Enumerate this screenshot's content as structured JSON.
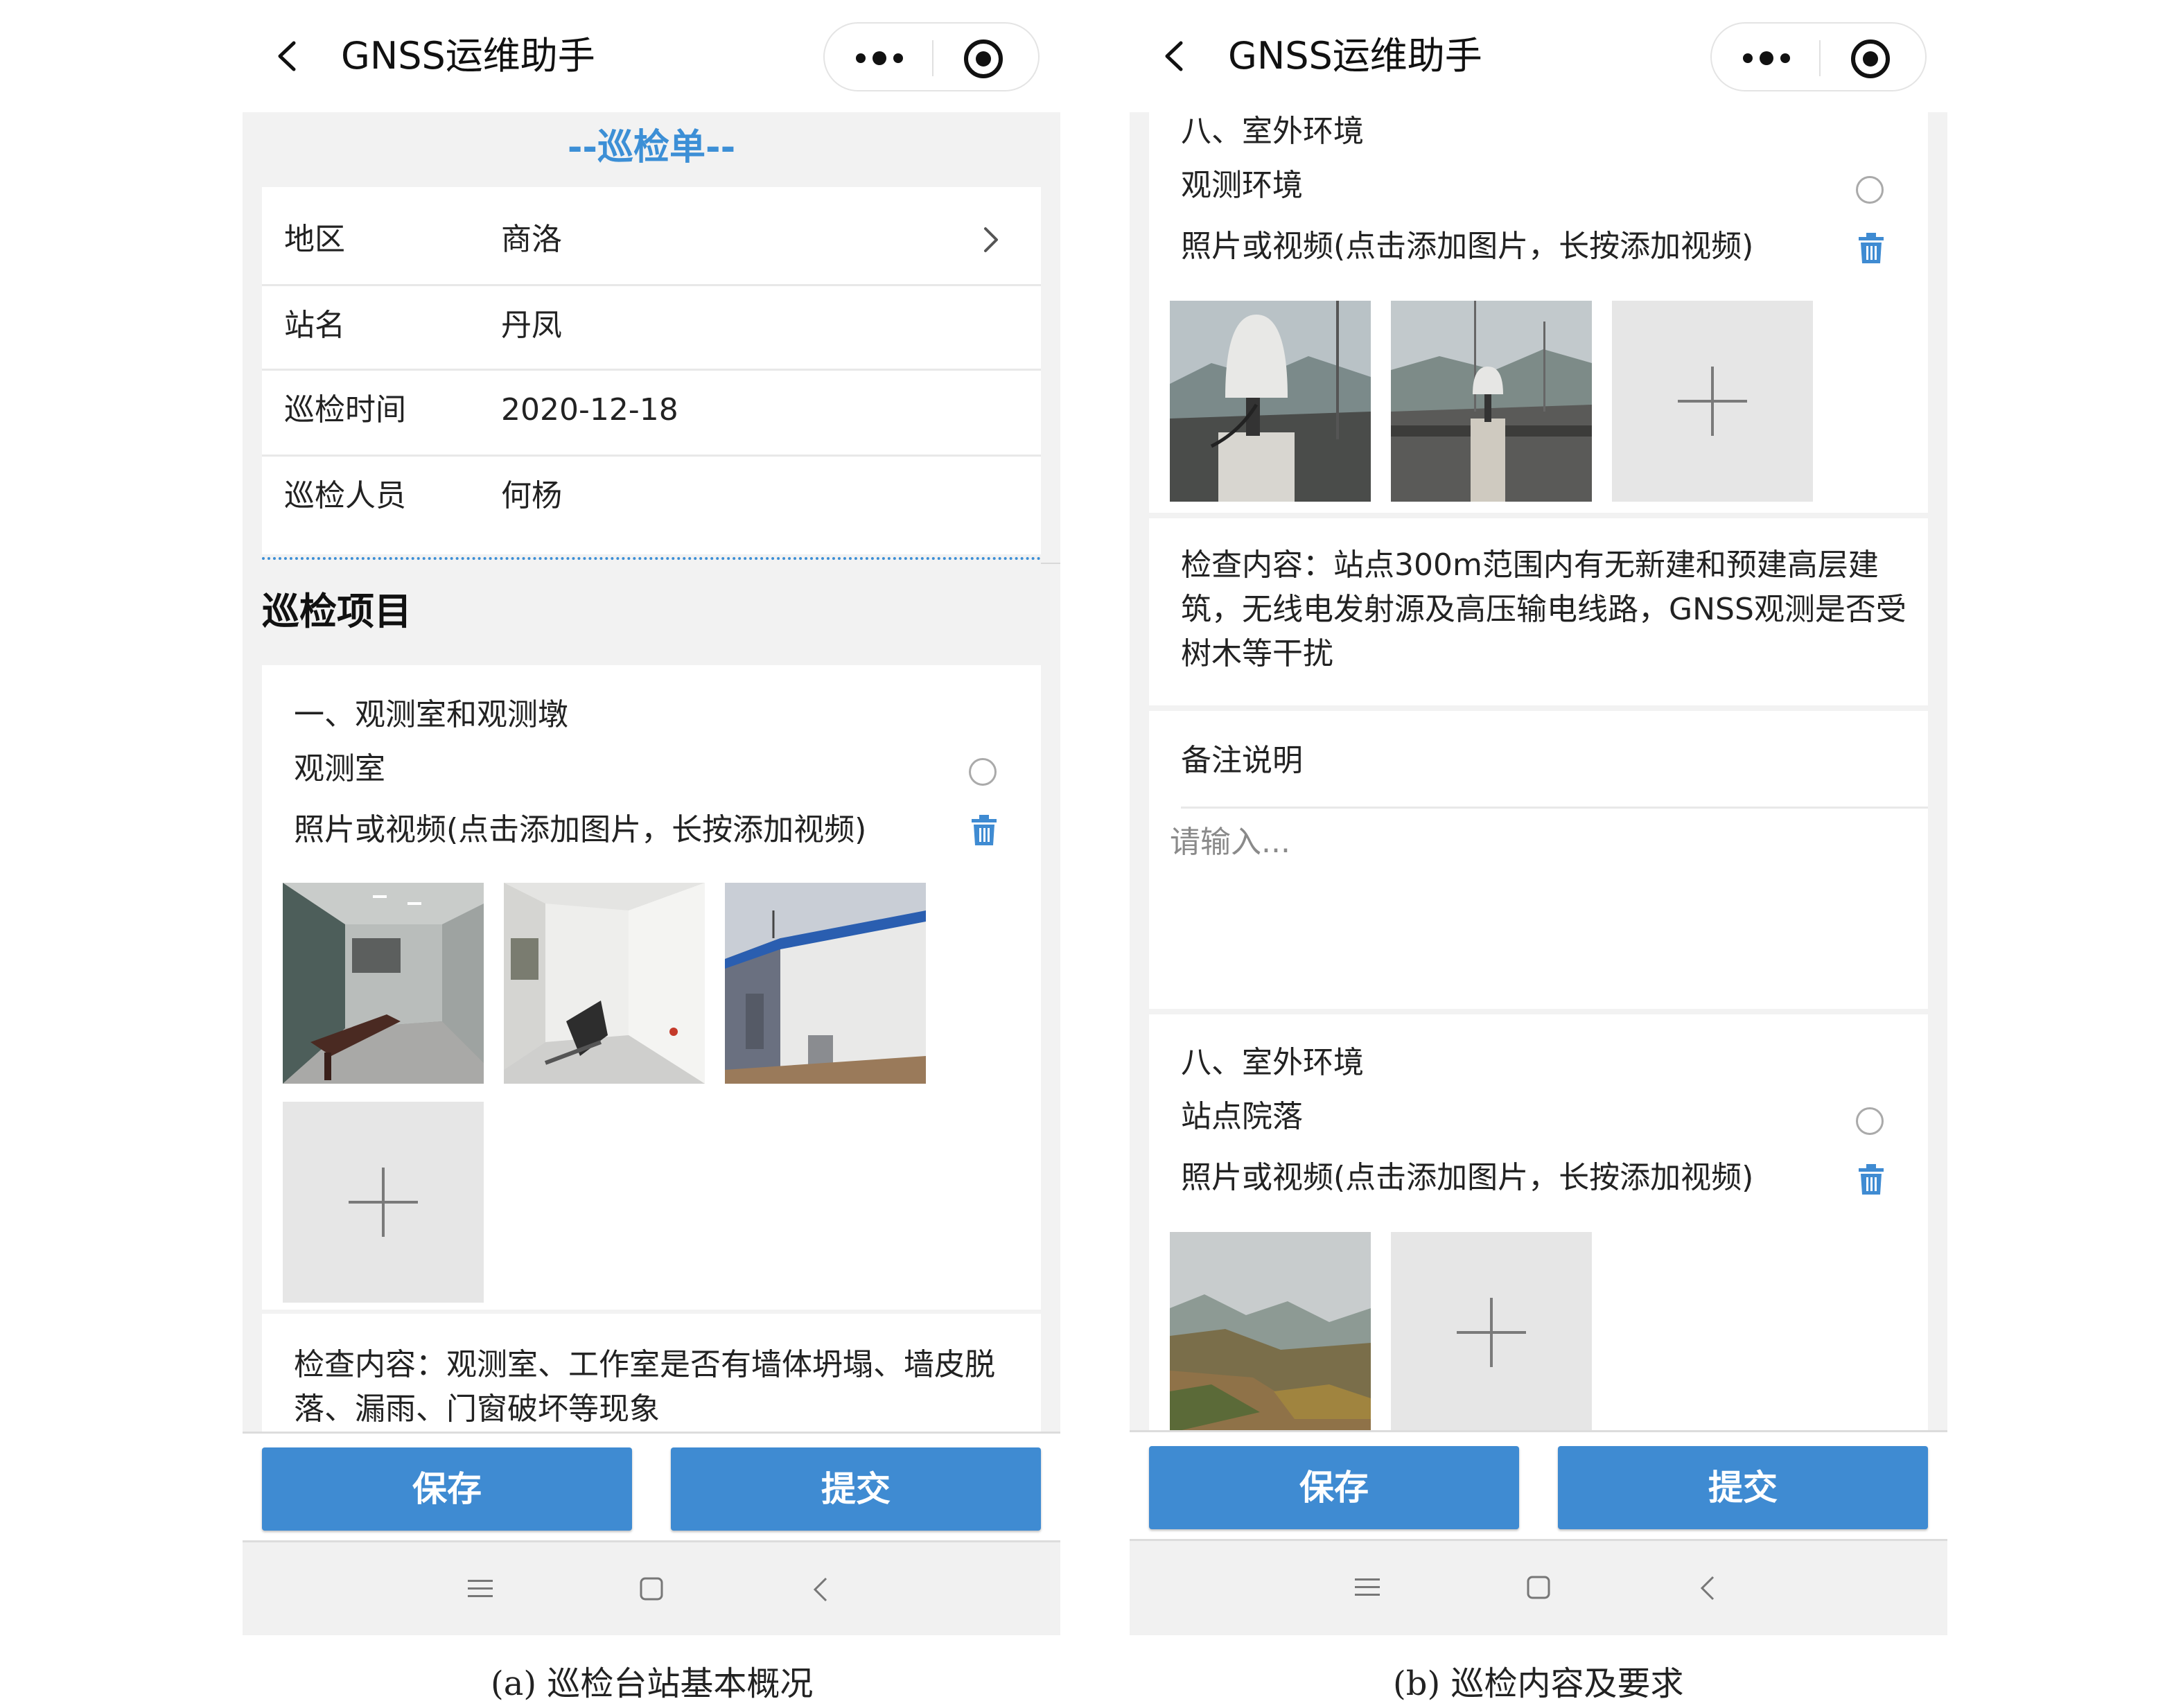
{
  "screen_a": {
    "app_title": "GNSS运维助手",
    "form_title": "--巡检单--",
    "info_rows": [
      {
        "label": "地区",
        "value": "商洛"
      },
      {
        "label": "站名",
        "value": "丹凤"
      },
      {
        "label": "巡检时间",
        "value": "2020-12-18"
      },
      {
        "label": "巡检人员",
        "value": "何杨"
      }
    ],
    "section_title": "巡检项目",
    "item": {
      "category": "一、观测室和观测墩",
      "name": "观测室",
      "media_label": "照片或视频(点击添加图片，长按添加视频)",
      "check_content": "检查内容：观测室、工作室是否有墙体坍塌、墙皮脱落、漏雨、门窗破坏等现象"
    },
    "save_label": "保存",
    "submit_label": "提交",
    "caption": "(a) 巡检台站基本概况"
  },
  "screen_b": {
    "app_title": "GNSS运维助手",
    "item1": {
      "category": "八、室外环境",
      "name": "观测环境",
      "media_label": "照片或视频(点击添加图片，长按添加视频)",
      "check_content": "检查内容：站点300m范围内有无新建和预建高层建筑，无线电发射源及高压输电线路，GNSS观测是否受树木等干扰"
    },
    "remark_label": "备注说明",
    "remark_placeholder": "请输入...",
    "item2": {
      "category": "八、室外环境",
      "name": "站点院落",
      "media_label": "照片或视频(点击添加图片，长按添加视频)"
    },
    "save_label": "保存",
    "submit_label": "提交",
    "caption": "(b) 巡检内容及要求"
  },
  "colors": {
    "accent_blue": "#3f8bd2",
    "title_blue": "#3c8fd6",
    "background_gray": "#f2f2f2"
  },
  "icons": [
    "back-arrow-icon",
    "more-dots-icon",
    "target-icon",
    "chevron-right-icon",
    "radio-icon",
    "trash-icon",
    "plus-icon",
    "nav-menu-icon",
    "nav-home-icon",
    "nav-back-icon"
  ]
}
